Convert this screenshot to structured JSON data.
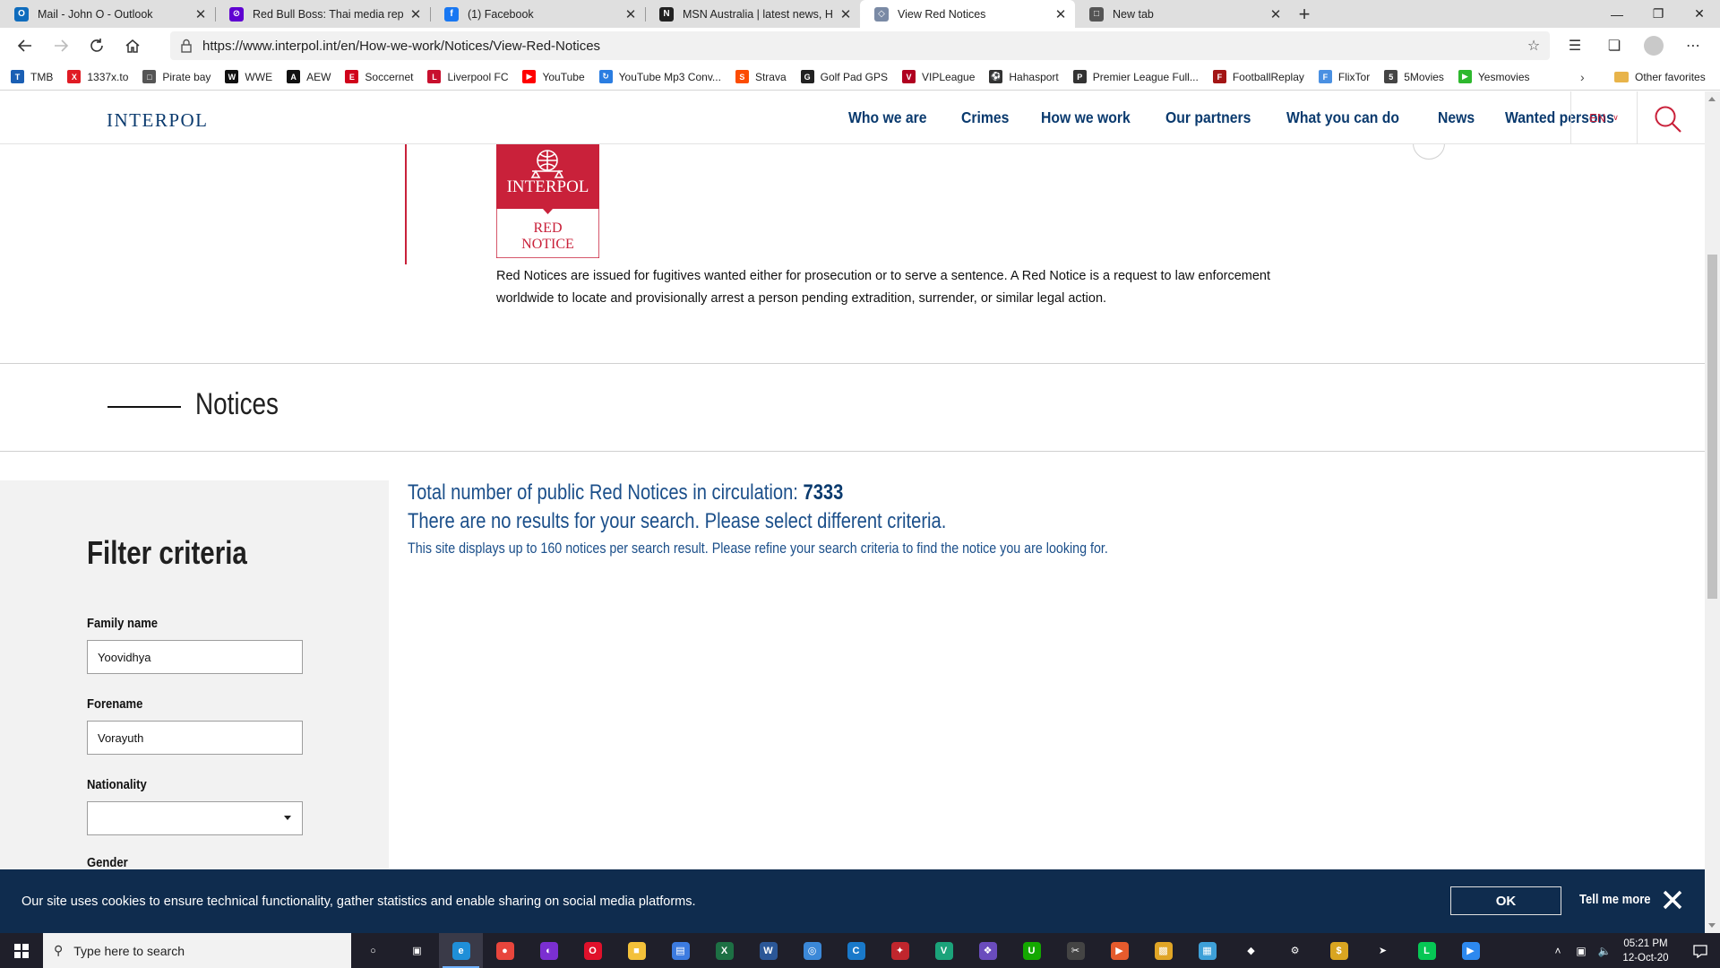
{
  "tabs": [
    {
      "title": "Mail - John O - Outlook",
      "icon": "outlook-icon",
      "color": "#0f6cbd",
      "glyph": "O"
    },
    {
      "title": "Red Bull Boss: Thai media report",
      "icon": "yahoo-icon",
      "color": "#5f01d1",
      "glyph": "⊘"
    },
    {
      "title": "(1) Facebook",
      "icon": "facebook-icon",
      "color": "#1877f2",
      "glyph": "f"
    },
    {
      "title": "MSN Australia | latest news, Hot",
      "icon": "msn-icon",
      "color": "#222222",
      "glyph": "N"
    },
    {
      "title": "View Red Notices",
      "icon": "interpol-icon",
      "color": "#7a8aa5",
      "glyph": "◇",
      "active": true
    },
    {
      "title": "New tab",
      "icon": "newtab-icon",
      "color": "#555555",
      "glyph": "□"
    }
  ],
  "address": {
    "url": "https://www.interpol.int/en/How-we-work/Notices/View-Red-Notices"
  },
  "bookmarks": [
    {
      "label": "TMB",
      "color": "#1a5fb4",
      "glyph": "T"
    },
    {
      "label": "1337x.to",
      "color": "#e01b24",
      "glyph": "X"
    },
    {
      "label": "Pirate bay",
      "color": "#555555",
      "glyph": "□"
    },
    {
      "label": "WWE",
      "color": "#111111",
      "glyph": "W"
    },
    {
      "label": "AEW",
      "color": "#111111",
      "glyph": "A"
    },
    {
      "label": "Soccernet",
      "color": "#d0021b",
      "glyph": "E"
    },
    {
      "label": "Liverpool FC",
      "color": "#c8102e",
      "glyph": "L"
    },
    {
      "label": "YouTube",
      "color": "#ff0000",
      "glyph": "▶"
    },
    {
      "label": "YouTube Mp3 Conv...",
      "color": "#2a7de1",
      "glyph": "↻"
    },
    {
      "label": "Strava",
      "color": "#fc4c02",
      "glyph": "S"
    },
    {
      "label": "Golf Pad GPS",
      "color": "#222222",
      "glyph": "G"
    },
    {
      "label": "VIPLeague",
      "color": "#b00020",
      "glyph": "V"
    },
    {
      "label": "Hahasport",
      "color": "#333333",
      "glyph": "⚽"
    },
    {
      "label": "Premier League Full...",
      "color": "#333333",
      "glyph": "P"
    },
    {
      "label": "FootballReplay",
      "color": "#a31515",
      "glyph": "F"
    },
    {
      "label": "FlixTor",
      "color": "#4a90e2",
      "glyph": "F"
    },
    {
      "label": "5Movies",
      "color": "#444444",
      "glyph": "5"
    },
    {
      "label": "Yesmovies",
      "color": "#2eb82e",
      "glyph": "▶"
    }
  ],
  "bookmarks_other": "Other favorites",
  "site": {
    "logo": "INTERPOL",
    "nav": [
      "Who we are",
      "Crimes",
      "How we work",
      "Our partners",
      "What you can do",
      "News",
      "Wanted persons"
    ],
    "lang": "EN",
    "badge": {
      "org": "INTERPOL",
      "line1": "RED",
      "line2": "NOTICE"
    },
    "intro": "Red Notices are issued for fugitives wanted either for prosecution or to serve a sentence. A Red Notice is a request to law enforcement worldwide to locate and provisionally arrest a person pending extradition, surrender, or similar legal action.",
    "section_title": "Notices"
  },
  "filter": {
    "title": "Filter criteria",
    "family_label": "Family name",
    "family_value": "Yoovidhya",
    "forename_label": "Forename",
    "forename_value": "Vorayuth",
    "nationality_label": "Nationality",
    "nationality_value": "",
    "gender_label": "Gender"
  },
  "results": {
    "total_label": "Total number of public Red Notices in circulation:",
    "total_count": "7333",
    "no_results": "There are no results for your search. Please select different criteria.",
    "limit_note": "This site displays up to 160 notices per search result. Please refine your search criteria to find the notice you are looking for."
  },
  "cookie": {
    "message": "Our site uses cookies to ensure technical functionality, gather statistics and enable sharing on social media platforms.",
    "ok": "OK",
    "more": "Tell me more"
  },
  "taskbar": {
    "search_placeholder": "Type here to search",
    "apps": [
      {
        "name": "cortana-icon",
        "color": "transparent",
        "glyph": "○"
      },
      {
        "name": "task-view-icon",
        "color": "transparent",
        "glyph": "▣"
      },
      {
        "name": "edge-icon",
        "color": "#1f8fd8",
        "glyph": "e",
        "active": true
      },
      {
        "name": "chrome-icon",
        "color": "#e8453c",
        "glyph": "●"
      },
      {
        "name": "podcast-icon",
        "color": "#7b2fd1",
        "glyph": "◐"
      },
      {
        "name": "opera-icon",
        "color": "#e0112b",
        "glyph": "O"
      },
      {
        "name": "file-explorer-icon",
        "color": "#f3c13a",
        "glyph": "■"
      },
      {
        "name": "store-icon",
        "color": "#3c7be0",
        "glyph": "▤"
      },
      {
        "name": "excel-icon",
        "color": "#1d7044",
        "glyph": "X"
      },
      {
        "name": "word-icon",
        "color": "#2b5797",
        "glyph": "W"
      },
      {
        "name": "browser-globe-icon",
        "color": "#3b88d8",
        "glyph": "◎"
      },
      {
        "name": "ccleaner-icon",
        "color": "#1979ca",
        "glyph": "C"
      },
      {
        "name": "security-icon",
        "color": "#c0262d",
        "glyph": "✦"
      },
      {
        "name": "vpn-icon",
        "color": "#1ba37a",
        "glyph": "V"
      },
      {
        "name": "paint-icon",
        "color": "#6a4cbd",
        "glyph": "❖"
      },
      {
        "name": "upwork-icon",
        "color": "#14a800",
        "glyph": "U"
      },
      {
        "name": "snip-icon",
        "color": "#444444",
        "glyph": "✂"
      },
      {
        "name": "media-icon",
        "color": "#e55b2d",
        "glyph": "▶"
      },
      {
        "name": "photos-icon",
        "color": "#e0a526",
        "glyph": "▩"
      },
      {
        "name": "remote-icon",
        "color": "#3ea0d8",
        "glyph": "▦"
      },
      {
        "name": "defender-icon",
        "color": "transparent",
        "glyph": "◆"
      },
      {
        "name": "settings-icon",
        "color": "transparent",
        "glyph": "⚙"
      },
      {
        "name": "money-icon",
        "color": "#d9a521",
        "glyph": "$"
      },
      {
        "name": "send-icon",
        "color": "transparent",
        "glyph": "➤"
      },
      {
        "name": "line-icon",
        "color": "#06c755",
        "glyph": "L"
      },
      {
        "name": "screen-icon",
        "color": "#2d89ef",
        "glyph": "▶"
      }
    ],
    "time": "05:21 PM",
    "date": "12-Oct-20"
  }
}
